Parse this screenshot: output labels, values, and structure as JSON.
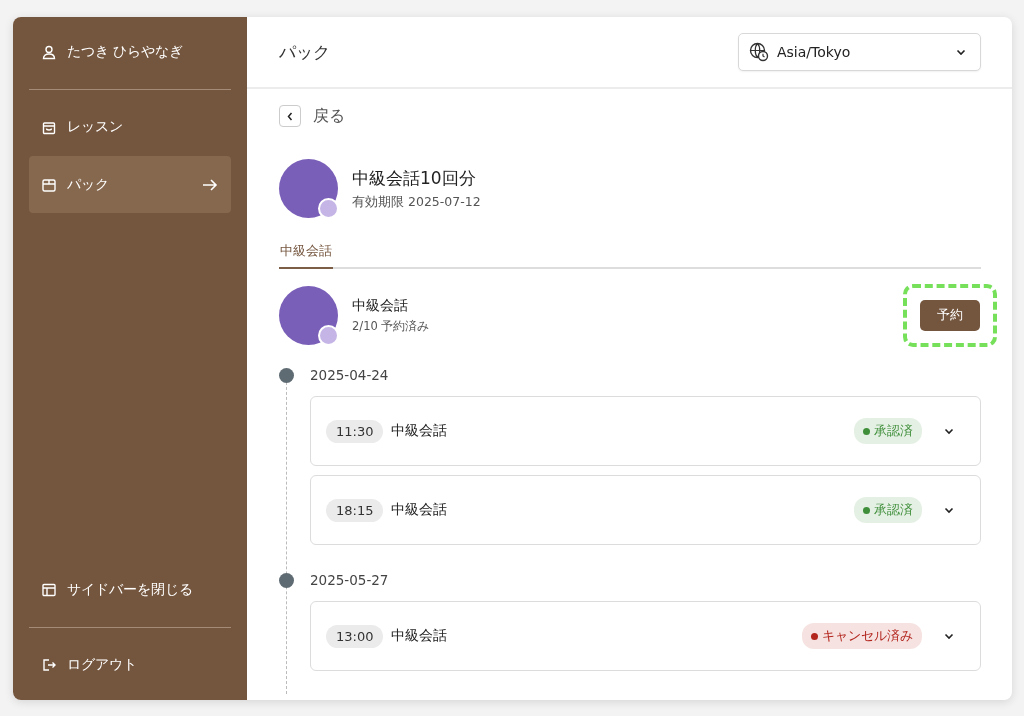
{
  "sidebar": {
    "user": {
      "name": "たつき ひらやなぎ"
    },
    "items": [
      {
        "label": "レッスン",
        "kind": "bag",
        "selected": false
      },
      {
        "label": "パック",
        "kind": "box",
        "selected": true
      }
    ],
    "footer_items": [
      {
        "label": "サイドバーを閉じる",
        "kind": "layout"
      },
      {
        "label": "ログアウト",
        "kind": "logout"
      }
    ]
  },
  "header": {
    "title": "パック",
    "timezone": "Asia/Tokyo"
  },
  "back": {
    "label": "戻る"
  },
  "pack": {
    "title": "中級会話10回分",
    "expiry": "有効期限 2025-07-12"
  },
  "tabs": [
    {
      "label": "中級会話",
      "selected": true
    }
  ],
  "lessons": [
    {
      "title": "中級会話",
      "progress": "2/10 予約済み",
      "button": "予約",
      "highlighted": true
    }
  ],
  "schedule": [
    {
      "date": "2025-04-24",
      "bookings": [
        {
          "time": "11:30",
          "title": "中級会話",
          "status": "承認済",
          "color": "#3f8f3a"
        },
        {
          "time": "18:15",
          "title": "中級会話",
          "status": "承認済",
          "color": "#3f8f3a"
        }
      ]
    },
    {
      "date": "2025-05-27",
      "bookings": [
        {
          "time": "13:00",
          "title": "中級会話",
          "status": "キャンセル済み",
          "color": "#b3261e"
        }
      ]
    }
  ]
}
